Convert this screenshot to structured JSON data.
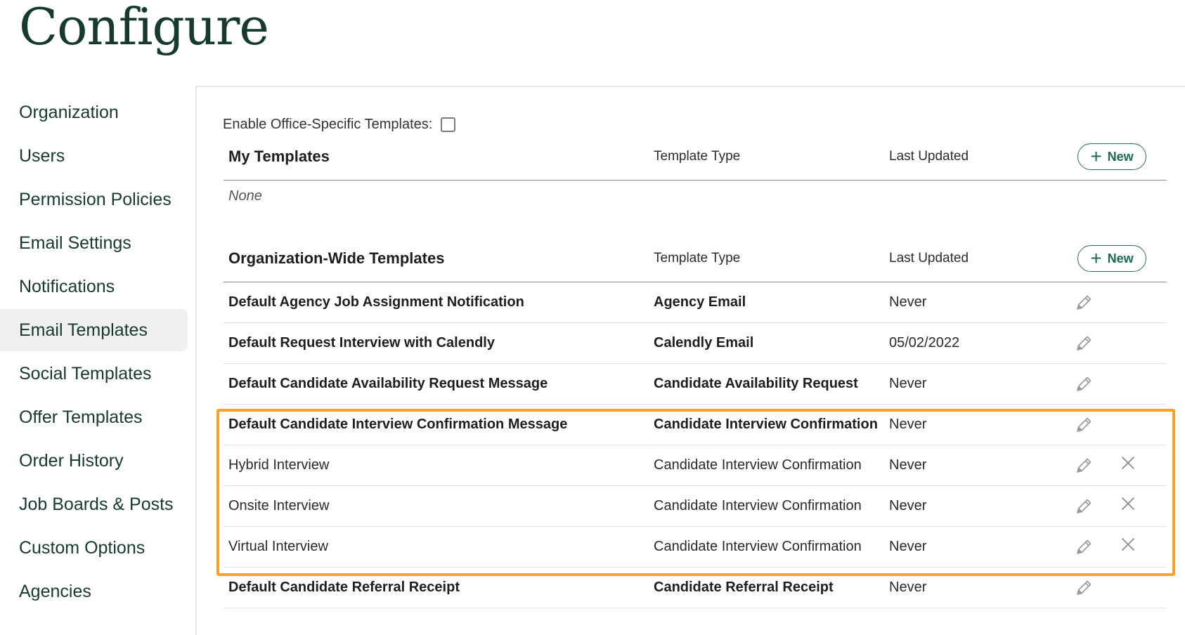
{
  "page": {
    "title": "Configure"
  },
  "sidebar": {
    "items": [
      {
        "label": "Organization"
      },
      {
        "label": "Users"
      },
      {
        "label": "Permission Policies"
      },
      {
        "label": "Email Settings"
      },
      {
        "label": "Notifications"
      },
      {
        "label": "Email Templates",
        "active": true
      },
      {
        "label": "Social Templates"
      },
      {
        "label": "Offer Templates"
      },
      {
        "label": "Order History"
      },
      {
        "label": "Job Boards & Posts"
      },
      {
        "label": "Custom Options"
      },
      {
        "label": "Agencies"
      }
    ]
  },
  "enable_office": {
    "label": "Enable Office-Specific Templates:",
    "checked": false
  },
  "my_templates": {
    "title": "My Templates",
    "col_type": "Template Type",
    "col_updated": "Last Updated",
    "new_label": "New",
    "empty_text": "None"
  },
  "org_templates": {
    "title": "Organization-Wide Templates",
    "col_type": "Template Type",
    "col_updated": "Last Updated",
    "new_label": "New",
    "rows": [
      {
        "name": "Default Agency Job Assignment Notification",
        "type": "Agency Email",
        "updated": "Never",
        "default": true,
        "deletable": false
      },
      {
        "name": "Default Request Interview with Calendly",
        "type": "Calendly Email",
        "updated": "05/02/2022",
        "default": true,
        "deletable": false
      },
      {
        "name": "Default Candidate Availability Request Message",
        "type": "Candidate Availability Request",
        "updated": "Never",
        "default": true,
        "deletable": false
      },
      {
        "name": "Default Candidate Interview Confirmation Message",
        "type": "Candidate Interview Confirmation",
        "updated": "Never",
        "default": true,
        "deletable": false
      },
      {
        "name": "Hybrid Interview",
        "type": "Candidate Interview Confirmation",
        "updated": "Never",
        "default": false,
        "deletable": true
      },
      {
        "name": "Onsite Interview",
        "type": "Candidate Interview Confirmation",
        "updated": "Never",
        "default": false,
        "deletable": true
      },
      {
        "name": "Virtual Interview",
        "type": "Candidate Interview Confirmation",
        "updated": "Never",
        "default": false,
        "deletable": true
      },
      {
        "name": "Default Candidate Referral Receipt",
        "type": "Candidate Referral Receipt",
        "updated": "Never",
        "default": true,
        "deletable": false
      }
    ]
  },
  "colors": {
    "brand": "#173a2e",
    "accent": "#1c6b4f",
    "highlight": "#f6a22b"
  },
  "icons": {
    "edit": "pencil-icon",
    "delete": "close-icon",
    "new": "plus-icon"
  }
}
